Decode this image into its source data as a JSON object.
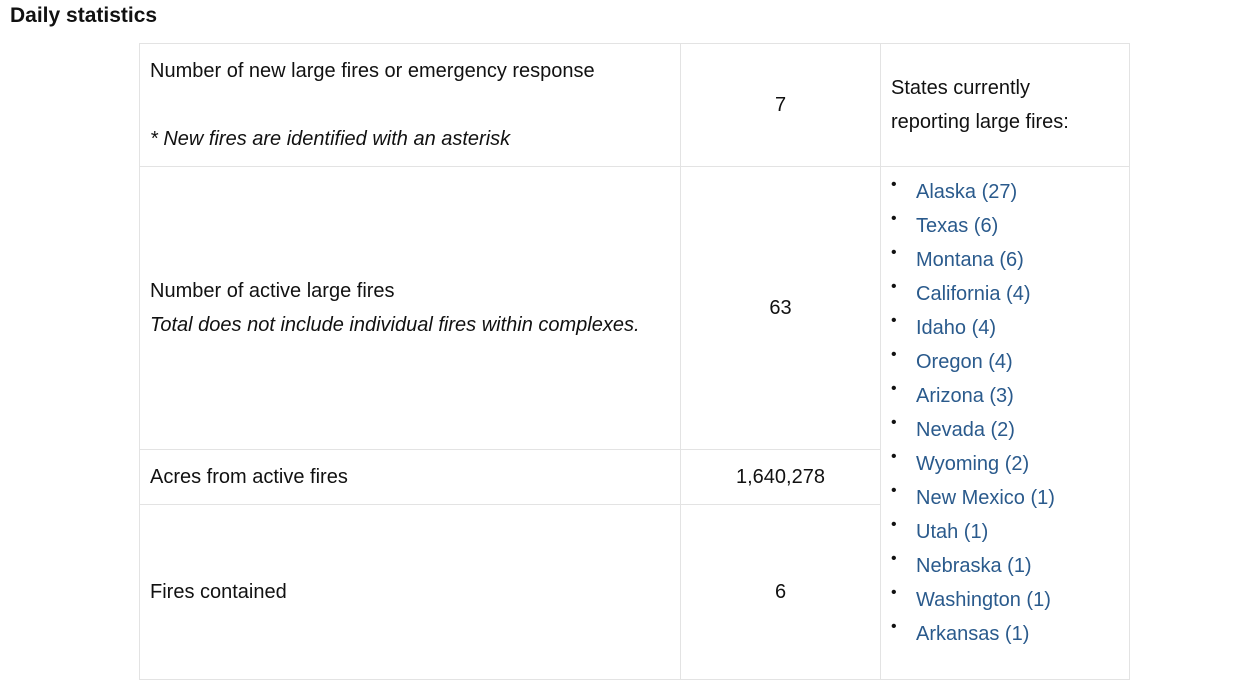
{
  "heading": "Daily statistics",
  "rows": {
    "new_fires": {
      "label": "Number of new large fires or emergency response",
      "note": "* New fires are identified with an asterisk",
      "value": "7"
    },
    "active_fires": {
      "label": "Number of active large fires",
      "note": "Total does not include individual fires within complexes.",
      "value": "63"
    },
    "acres": {
      "label": "Acres from active fires",
      "value": "1,640,278"
    },
    "contained": {
      "label": "Fires contained",
      "value": "6"
    }
  },
  "states_header_line1": "States currently",
  "states_header_line2": "reporting large fires:",
  "bullet": "•",
  "states": [
    "Alaska (27)",
    "Texas (6)",
    "Montana (6)",
    "California (4)",
    "Idaho (4)",
    "Oregon (4)",
    "Arizona (3)",
    "Nevada (2)",
    "Wyoming (2)",
    "New Mexico (1)",
    "Utah (1)",
    "Nebraska (1)",
    "Washington (1)",
    "Arkansas (1)"
  ],
  "colors": {
    "link": "#2a5a8c",
    "border": "#e3e3e3",
    "text": "#111111"
  }
}
